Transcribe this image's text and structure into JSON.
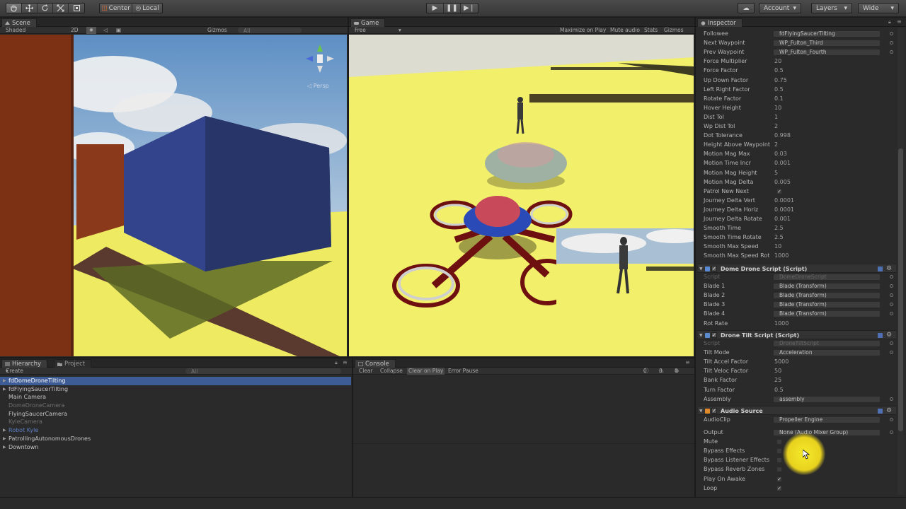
{
  "toolbar": {
    "tools": [
      "hand-icon",
      "move-icon",
      "rotate-icon",
      "scale-icon",
      "rect-icon"
    ],
    "pivot": "Center",
    "space": "Local",
    "account": "Account",
    "layers": "Layers",
    "layout": "Wide"
  },
  "scene": {
    "tab": "Scene",
    "shading": "Shaded",
    "mode2d": "2D",
    "gizmos": "Gizmos",
    "search": "All",
    "persp": "Persp"
  },
  "game": {
    "tab": "Game",
    "aspect": "Free Aspect",
    "maximize": "Maximize on Play",
    "mute": "Mute audio",
    "stats": "Stats",
    "gizmos": "Gizmos"
  },
  "hierarchy": {
    "tab": "Hierarchy",
    "tab2": "Project",
    "create": "Create",
    "search": "All",
    "items": [
      {
        "label": "fdDomeDroneTilting",
        "style": "sel",
        "arrow": true
      },
      {
        "label": "fdFlyingSaucerTilting",
        "style": "",
        "arrow": true
      },
      {
        "label": "Main Camera",
        "style": "",
        "arrow": false
      },
      {
        "label": "DomeDroneCamera",
        "style": "dim",
        "arrow": false
      },
      {
        "label": "FlyingSaucerCamera",
        "style": "",
        "arrow": false
      },
      {
        "label": "KyleCamera",
        "style": "dim",
        "arrow": false
      },
      {
        "label": "Robot Kyle",
        "style": "blue",
        "arrow": true
      },
      {
        "label": "PatrollingAutonomousDrones",
        "style": "",
        "arrow": true
      },
      {
        "label": "Downtown",
        "style": "",
        "arrow": true
      }
    ]
  },
  "console": {
    "tab": "Console",
    "clear": "Clear",
    "collapse": "Collapse",
    "clearOnPlay": "Clear on Play",
    "errorPause": "Error Pause",
    "counts": [
      "0",
      "0",
      "0"
    ]
  },
  "inspector": {
    "tab": "Inspector",
    "rows1": [
      {
        "label": "Followee",
        "field": "fdFlyingSaucerTilting"
      },
      {
        "label": "Next Waypoint",
        "field": "WP_Fulton_Third"
      },
      {
        "label": "Prev Waypoint",
        "field": "WP_Fulton_Fourth"
      },
      {
        "label": "Force Multiplier",
        "value": "20"
      },
      {
        "label": "Force Factor",
        "value": "0.5"
      },
      {
        "label": "Up Down Factor",
        "value": "0.75"
      },
      {
        "label": "Left Right Factor",
        "value": "0.5"
      },
      {
        "label": "Rotate Factor",
        "value": "0.1"
      },
      {
        "label": "Hover Height",
        "value": "10"
      },
      {
        "label": "Dist Tol",
        "value": "1"
      },
      {
        "label": "Wp Dist Tol",
        "value": "2"
      },
      {
        "label": "Dot Tolerance",
        "value": "0.998"
      },
      {
        "label": "Height Above Waypoint",
        "value": "2"
      },
      {
        "label": "Motion Mag Max",
        "value": "0.03"
      },
      {
        "label": "Motion Time Incr",
        "value": "0.001"
      },
      {
        "label": "Motion Mag Height",
        "value": "5"
      },
      {
        "label": "Motion Mag Delta",
        "value": "0.005"
      },
      {
        "label": "Patrol New Next",
        "check": "✓"
      },
      {
        "label": "Journey Delta Vert",
        "value": "0.0001"
      },
      {
        "label": "Journey Delta Horiz",
        "value": "0.0001"
      },
      {
        "label": "Journey Delta Rotate",
        "value": "0.001"
      },
      {
        "label": "Smooth Time",
        "value": "2.5"
      },
      {
        "label": "Smooth Time Rotate",
        "value": "2.5"
      },
      {
        "label": "Smooth Max Speed",
        "value": "10"
      },
      {
        "label": "Smooth Max Speed Rot",
        "value": "1000"
      }
    ],
    "comp1": "Dome Drone Script (Script)",
    "rows2": [
      {
        "label": "Script",
        "field": "DomeDroneScript",
        "dim": true
      },
      {
        "label": "Blade 1",
        "field": "Blade (Transform)"
      },
      {
        "label": "Blade 2",
        "field": "Blade (Transform)"
      },
      {
        "label": "Blade 3",
        "field": "Blade (Transform)"
      },
      {
        "label": "Blade 4",
        "field": "Blade (Transform)"
      },
      {
        "label": "Rot Rate",
        "value": "1000"
      }
    ],
    "comp2": "Drone Tilt Script (Script)",
    "rows3": [
      {
        "label": "Script",
        "field": "DroneTiltScript",
        "dim": true
      },
      {
        "label": "Tilt Mode",
        "field": "Acceleration"
      },
      {
        "label": "Tilt Accel Factor",
        "value": "5000"
      },
      {
        "label": "Tilt Veloc Factor",
        "value": "50"
      },
      {
        "label": "Bank Factor",
        "value": "25"
      },
      {
        "label": "Turn Factor",
        "value": "0.5"
      },
      {
        "label": "Assembly",
        "field": "assembly"
      }
    ],
    "comp3": "Audio Source",
    "rows4": [
      {
        "label": "AudioClip",
        "field": "Propeller Engine"
      },
      {
        "label": "Output",
        "field": "None (Audio Mixer Group)"
      },
      {
        "label": "Mute",
        "check": ""
      },
      {
        "label": "Bypass Effects",
        "check": ""
      },
      {
        "label": "Bypass Listener Effects",
        "check": ""
      },
      {
        "label": "Bypass Reverb Zones",
        "check": ""
      },
      {
        "label": "Play On Awake",
        "check": "✓"
      },
      {
        "label": "Loop",
        "check": "✓"
      }
    ]
  },
  "colors": {
    "selection": "#3d5b94",
    "ground": "#f2ef6a",
    "sky": "#8fb6d8",
    "cube": "#2c3a7a",
    "cursor": "#f4ea2a"
  }
}
